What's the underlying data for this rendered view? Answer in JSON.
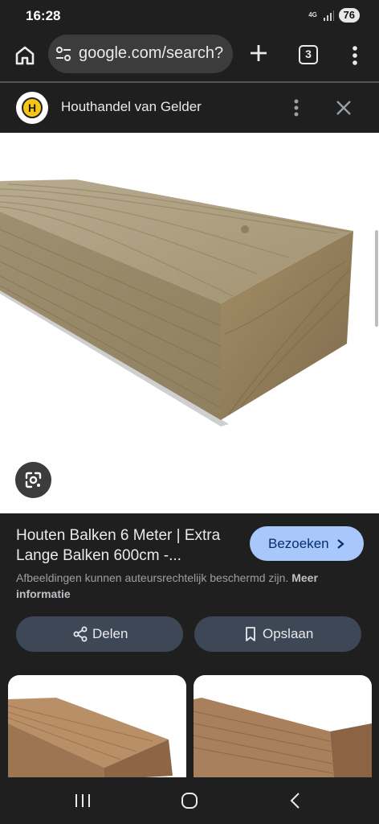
{
  "status": {
    "time": "16:28",
    "network": "4G",
    "battery": "76"
  },
  "browser": {
    "url": "google.com/search?",
    "tab_count": "3"
  },
  "source": {
    "favicon_letter": "H",
    "name": "Houthandel van Gelder"
  },
  "result": {
    "title": "Houten Balken 6 Meter | Extra Lange Balken 600cm -...",
    "visit_label": "Bezoeken",
    "disclaimer_text": "Afbeeldingen kunnen auteursrechtelijk beschermd zijn.",
    "disclaimer_link": "Meer informatie",
    "share_label": "Delen",
    "save_label": "Opslaan"
  },
  "colors": {
    "accent_button": "#a8c7fa",
    "secondary_button": "#3d4756",
    "background": "#1f1f1f"
  },
  "icons": [
    "home-icon",
    "tune-icon",
    "plus-icon",
    "tabs-icon",
    "more-vert-icon",
    "close-icon",
    "lens-icon",
    "chevron-right-icon",
    "share-icon",
    "bookmark-icon",
    "recent-apps-icon",
    "home-circle-icon",
    "back-icon"
  ]
}
